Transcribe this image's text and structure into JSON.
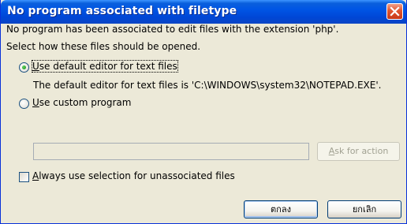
{
  "window": {
    "title": "No program associated with filetype"
  },
  "content": {
    "info_line": "No program has been associated to edit files with the extension 'php'.",
    "prompt_line": "Select how these files should be opened.",
    "option_default": {
      "accel": "U",
      "rest": "se default editor for text files",
      "selected": true
    },
    "default_info": "The default editor for text files is 'C:\\WINDOWS\\system32\\NOTEPAD.EXE'.",
    "option_custom": {
      "accel": "U",
      "rest": "se custom program",
      "selected": false
    },
    "custom_path_value": "",
    "ask_button": {
      "accel": "A",
      "rest": "sk for action"
    },
    "always_checkbox": {
      "accel": "A",
      "rest": "lways use selection for unassociated files",
      "checked": false
    }
  },
  "buttons": {
    "ok": "ตกลง",
    "cancel": "ยกเลิก"
  }
}
